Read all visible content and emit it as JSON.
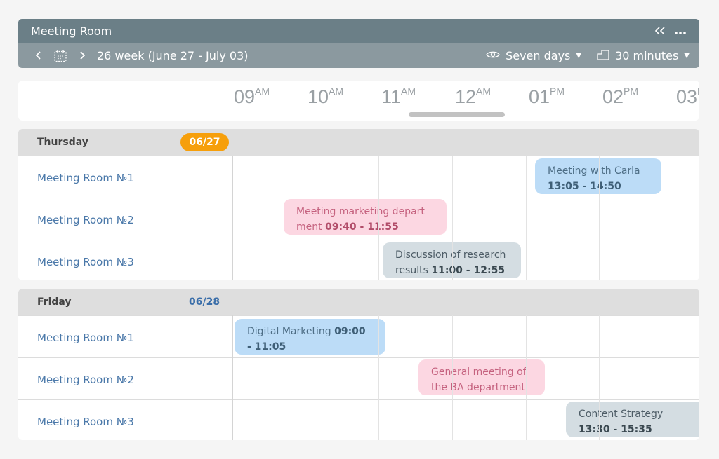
{
  "header": {
    "title": "Meeting Room",
    "week_label": "26 week (June 27 - July 03)",
    "view_label": "Seven days",
    "step_label": "30 minutes"
  },
  "timeline": [
    {
      "hour": "09",
      "period": "AM"
    },
    {
      "hour": "10",
      "period": "AM"
    },
    {
      "hour": "11",
      "period": "AM"
    },
    {
      "hour": "12",
      "period": "AM"
    },
    {
      "hour": "01",
      "period": "PM"
    },
    {
      "hour": "02",
      "period": "PM"
    },
    {
      "hour": "03",
      "period": "PM"
    }
  ],
  "days": [
    {
      "name": "Thursday",
      "date": "06/27",
      "rooms": [
        "Meeting Room №1",
        "Meeting Room №2",
        "Meeting Room №3"
      ],
      "events": [
        {
          "title": "Meeting with Carla",
          "time": "13:05 - 14:50",
          "room": 0,
          "color": "blue"
        },
        {
          "title": "Meeting marketing depart ment",
          "time": "09:40 - 11:55",
          "room": 1,
          "color": "pink"
        },
        {
          "title": "Discussion of research results",
          "time": "11:00 - 12:55",
          "room": 2,
          "color": "grey"
        }
      ]
    },
    {
      "name": "Friday",
      "date": "06/28",
      "rooms": [
        "Meeting Room №1",
        "Meeting Room №2",
        "Meeting Room №3"
      ],
      "events": [
        {
          "title": "Digital Marketing",
          "time": "09:00 - 11:05",
          "room": 0,
          "color": "blue"
        },
        {
          "title": "General meeting of the BA department",
          "time": "",
          "room": 1,
          "color": "pink"
        },
        {
          "title": "Content Strategy",
          "time": "13:30 - 15:35",
          "room": 2,
          "color": "grey"
        }
      ]
    }
  ],
  "colors": {
    "title_bar": "#6b7f87",
    "nav_bar": "#8b999f",
    "today_badge": "#f69f0b",
    "room_label": "#4a78a9",
    "event_blue": "#bcdcf7",
    "event_pink": "#fcd7e2",
    "event_grey": "#d4dde2"
  }
}
